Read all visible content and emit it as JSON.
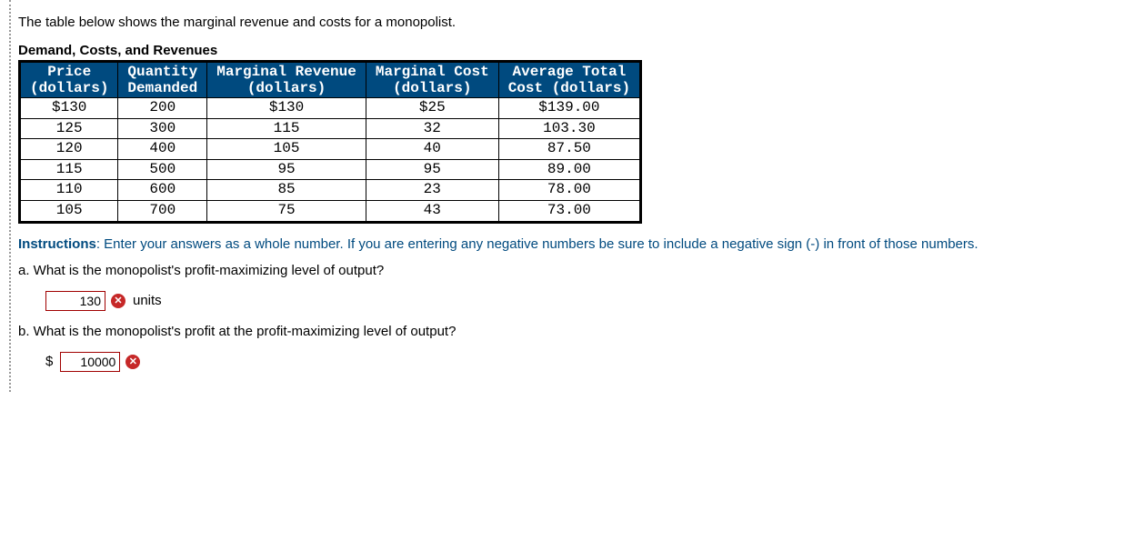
{
  "intro": "The table below shows the marginal revenue and costs for a monopolist.",
  "table_title": "Demand, Costs, and Revenues",
  "headers": {
    "c1a": "Price",
    "c1b": "(dollars)",
    "c2a": "Quantity",
    "c2b": "Demanded",
    "c3a": "Marginal Revenue",
    "c3b": "(dollars)",
    "c4a": "Marginal Cost",
    "c4b": "(dollars)",
    "c5a": "Average Total",
    "c5b": "Cost (dollars)"
  },
  "rows": [
    {
      "price": "$130",
      "qty": "200",
      "mr": "$130",
      "mc": "$25",
      "atc": "$139.00"
    },
    {
      "price": "125",
      "qty": "300",
      "mr": "115",
      "mc": "32",
      "atc": "103.30"
    },
    {
      "price": "120",
      "qty": "400",
      "mr": "105",
      "mc": "40",
      "atc": "87.50"
    },
    {
      "price": "115",
      "qty": "500",
      "mr": "95",
      "mc": "95",
      "atc": "89.00"
    },
    {
      "price": "110",
      "qty": "600",
      "mr": "85",
      "mc": "23",
      "atc": "78.00"
    },
    {
      "price": "105",
      "qty": "700",
      "mr": "75",
      "mc": "43",
      "atc": "73.00"
    }
  ],
  "instructions_label": "Instructions",
  "instructions_text": ": Enter your answers as a whole number. If you are entering any negative numbers be sure to include a negative sign (-) in front of those numbers.",
  "qa": {
    "text": "a. What is the monopolist's profit-maximizing level of output?",
    "value": "130",
    "units": "units"
  },
  "qb": {
    "text": "b. What is the monopolist's profit at the profit-maximizing level of output?",
    "currency": "$",
    "value": "10000"
  }
}
